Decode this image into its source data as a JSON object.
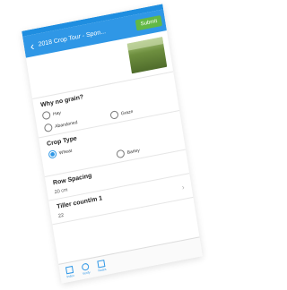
{
  "header": {
    "back_icon": "chevron-left-icon",
    "title": "2018 Crop Tour - Spon...",
    "submit_label": "Submit"
  },
  "why_no_grain": {
    "label": "Why no grain?",
    "options": [
      "Hay",
      "Graze",
      "Abandoned"
    ]
  },
  "crop_type": {
    "label": "Crop Type",
    "options": [
      "Wheat",
      "Barley"
    ],
    "selected": "Wheat"
  },
  "row_spacing": {
    "label": "Row Spacing",
    "value": "20 cm"
  },
  "tiller_count": {
    "label": "Tiller count/m 1",
    "value": "22"
  },
  "bottom_nav": {
    "items": [
      {
        "label": "Index",
        "icon": "index-icon"
      },
      {
        "label": "Verify",
        "icon": "verify-icon"
      },
      {
        "label": "Notes",
        "icon": "notes-icon"
      }
    ]
  },
  "colors": {
    "header": "#2f97e6",
    "submit": "#62b845",
    "selected_radio": "#2f97e6"
  }
}
